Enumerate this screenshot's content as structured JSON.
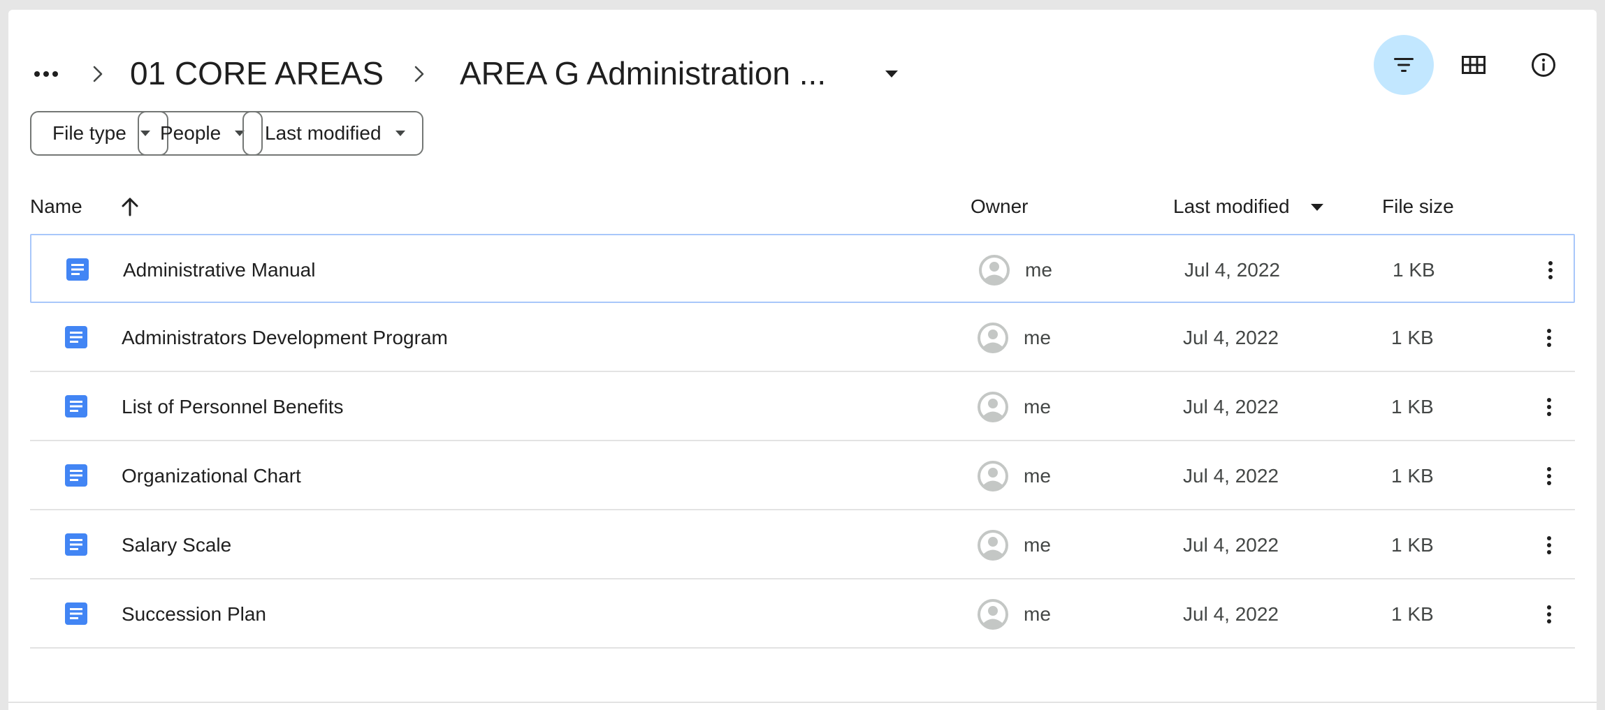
{
  "breadcrumb": {
    "more_label": "More folders",
    "items": [
      {
        "label": "01 CORE AREAS"
      },
      {
        "label": "AREA G Administration ..."
      }
    ]
  },
  "header_actions": {
    "filter": "filter-icon",
    "grid": "grid-view-icon",
    "info": "info-icon"
  },
  "filters": [
    {
      "label": "File type"
    },
    {
      "label": "People"
    },
    {
      "label": "Last modified"
    }
  ],
  "columns": {
    "name": "Name",
    "owner": "Owner",
    "last_modified": "Last modified",
    "file_size": "File size"
  },
  "files": [
    {
      "name": "Administrative Manual",
      "owner": "me",
      "modified": "Jul 4, 2022",
      "size": "1 KB",
      "selected": true
    },
    {
      "name": "Administrators Development Program",
      "owner": "me",
      "modified": "Jul 4, 2022",
      "size": "1 KB"
    },
    {
      "name": "List of Personnel Benefits",
      "owner": "me",
      "modified": "Jul 4, 2022",
      "size": "1 KB"
    },
    {
      "name": "Organizational Chart",
      "owner": "me",
      "modified": "Jul 4, 2022",
      "size": "1 KB"
    },
    {
      "name": "Salary Scale",
      "owner": "me",
      "modified": "Jul 4, 2022",
      "size": "1 KB"
    },
    {
      "name": "Succession Plan",
      "owner": "me",
      "modified": "Jul 4, 2022",
      "size": "1 KB"
    }
  ],
  "colors": {
    "doc_icon": "#4285f4",
    "active_button": "#c2e7ff",
    "selected_border": "#a8c7fa",
    "avatar": "#c4c7c5"
  }
}
